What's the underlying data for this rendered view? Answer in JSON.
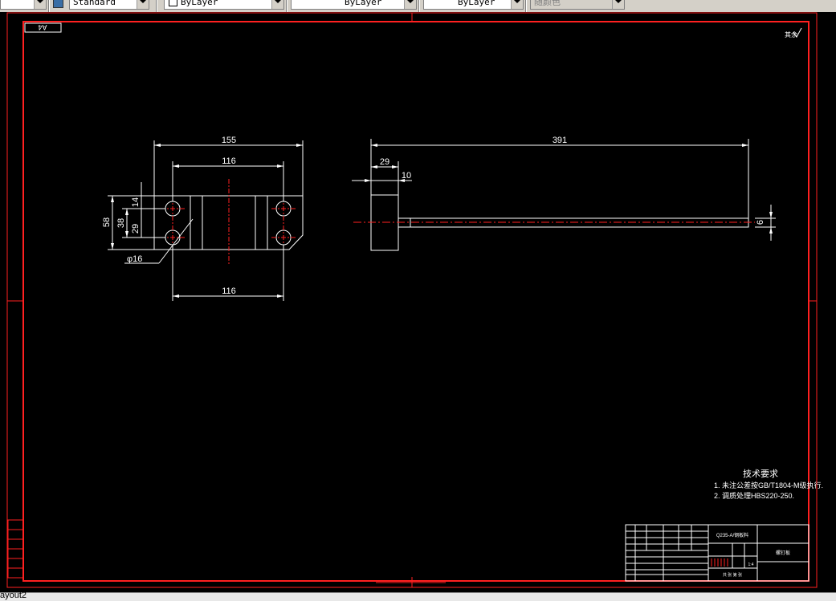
{
  "toolbar": {
    "text_style": "Standard",
    "layer": "ByLayer",
    "linetype": "ByLayer",
    "lineweight": "ByLayer",
    "color": "随颜色"
  },
  "drawing": {
    "sheet_label": "A4",
    "roughness_mark": "其余",
    "front_view": {
      "dim_overall_width": "155",
      "dim_top_inner": "116",
      "dim_bottom_inner": "116",
      "dim_height": "58",
      "dim_hole_spacing": "38",
      "dim_top_offset": "14",
      "dim_middle": "29",
      "dim_hole_dia": "φ16"
    },
    "side_view": {
      "dim_length": "391",
      "dim_head": "29",
      "dim_step": "10",
      "dim_rod": "6"
    },
    "tech_req": {
      "title": "技术要求",
      "line1": "1. 未注公差按GB/T1804-M级执行.",
      "line2": "2. 调质处理HBS220-250."
    },
    "title_block": {
      "material": "Q235-A/钢板料",
      "drawing_name": "螺钉板",
      "scale_row": "共  张  第  张",
      "sheet_no": "1:4"
    }
  },
  "layout_tab": "ayout2"
}
